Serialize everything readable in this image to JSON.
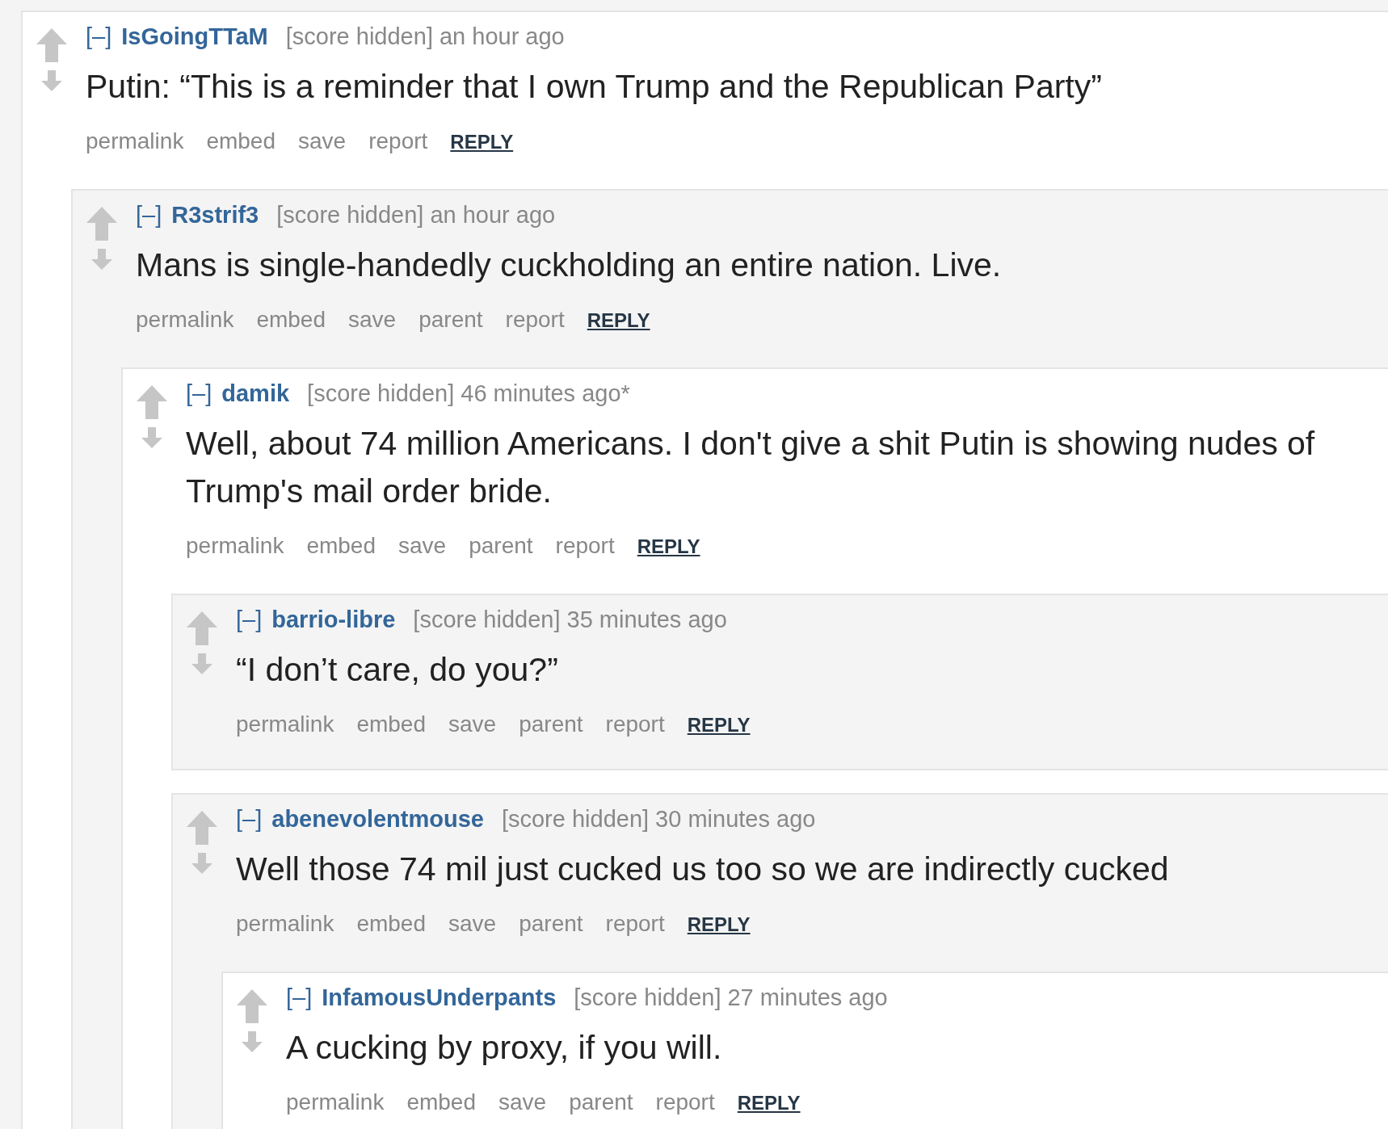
{
  "comments": [
    {
      "toggle": "[–]",
      "author": "IsGoingTTaM",
      "score": "[score hidden]",
      "time": "an hour ago",
      "body": "Putin: “This is a reminder that I own Trump and the Republican Party”",
      "actions": [
        "permalink",
        "embed",
        "save",
        "report"
      ],
      "reply": "REPLY",
      "children": [
        {
          "toggle": "[–]",
          "author": "R3strif3",
          "score": "[score hidden]",
          "time": "an hour ago",
          "body": "Mans is single-handedly cuckholding an entire nation. Live.",
          "actions": [
            "permalink",
            "embed",
            "save",
            "parent",
            "report"
          ],
          "reply": "REPLY",
          "children": [
            {
              "toggle": "[–]",
              "author": "damik",
              "score": "[score hidden]",
              "time": "46 minutes ago*",
              "body": "Well, about 74 million Americans. I don't give a shit Putin is showing nudes of Trump's mail order bride.",
              "actions": [
                "permalink",
                "embed",
                "save",
                "parent",
                "report"
              ],
              "reply": "REPLY",
              "children": [
                {
                  "toggle": "[–]",
                  "author": "barrio-libre",
                  "score": "[score hidden]",
                  "time": "35 minutes ago",
                  "body": "“I don’t care, do you?”",
                  "actions": [
                    "permalink",
                    "embed",
                    "save",
                    "parent",
                    "report"
                  ],
                  "reply": "REPLY"
                },
                {
                  "toggle": "[–]",
                  "author": "abenevolentmouse",
                  "score": "[score hidden]",
                  "time": "30 minutes ago",
                  "body": "Well those 74 mil just cucked us too so we are indirectly cucked",
                  "actions": [
                    "permalink",
                    "embed",
                    "save",
                    "parent",
                    "report"
                  ],
                  "reply": "REPLY",
                  "children": [
                    {
                      "toggle": "[–]",
                      "author": "InfamousUnderpants",
                      "score": "[score hidden]",
                      "time": "27 minutes ago",
                      "body": "A cucking by proxy, if you will.",
                      "actions": [
                        "permalink",
                        "embed",
                        "save",
                        "parent",
                        "report"
                      ],
                      "reply": "REPLY"
                    }
                  ]
                }
              ]
            }
          ]
        }
      ]
    }
  ]
}
